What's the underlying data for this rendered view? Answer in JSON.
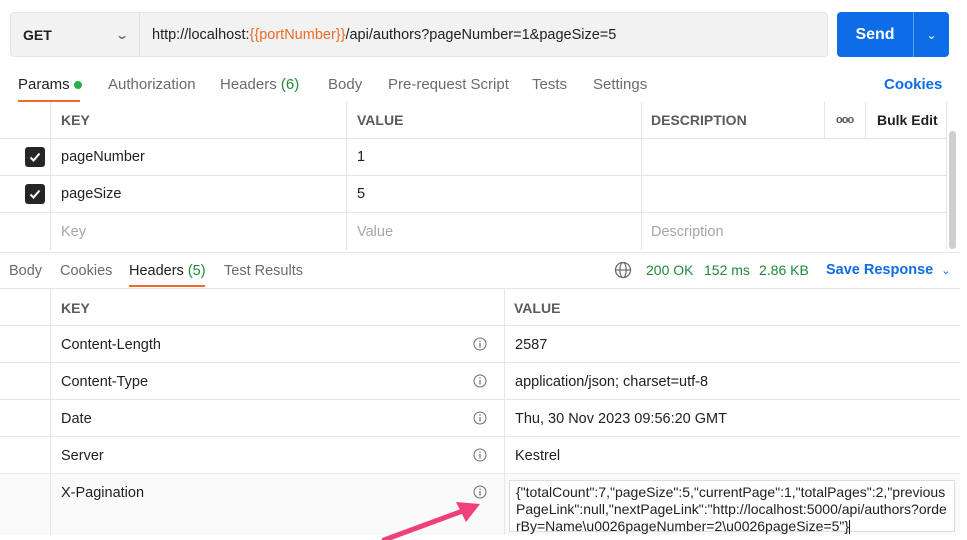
{
  "request": {
    "method": "GET",
    "url_prefix": "http://localhost:",
    "url_variable": "{{portNumber}}",
    "url_suffix": "/api/authors?pageNumber=1&pageSize=5",
    "send_label": "Send"
  },
  "req_tabs": {
    "params": "Params",
    "authorization": "Authorization",
    "headers": "Headers",
    "headers_count": "(6)",
    "body": "Body",
    "prerequest": "Pre-request Script",
    "tests": "Tests",
    "settings": "Settings",
    "cookies": "Cookies"
  },
  "params_table": {
    "col_key": "KEY",
    "col_value": "VALUE",
    "col_description": "DESCRIPTION",
    "more_label": "ooo",
    "bulk_edit": "Bulk Edit",
    "rows": [
      {
        "key": "pageNumber",
        "value": "1",
        "checked": true
      },
      {
        "key": "pageSize",
        "value": "5",
        "checked": true
      }
    ],
    "placeholder_key": "Key",
    "placeholder_value": "Value",
    "placeholder_description": "Description"
  },
  "res_tabs": {
    "body": "Body",
    "cookies": "Cookies",
    "headers": "Headers",
    "headers_count": "(5)",
    "test_results": "Test Results"
  },
  "status": {
    "code": "200 OK",
    "time": "152 ms",
    "size": "2.86 KB",
    "save_response": "Save Response"
  },
  "headers_table": {
    "col_key": "KEY",
    "col_value": "VALUE",
    "rows": [
      {
        "key": "Content-Length",
        "value": "2587"
      },
      {
        "key": "Content-Type",
        "value": "application/json; charset=utf-8"
      },
      {
        "key": "Date",
        "value": "Thu, 30 Nov 2023 09:56:20 GMT"
      },
      {
        "key": "Server",
        "value": "Kestrel"
      }
    ],
    "pagination_key": "X-Pagination",
    "pagination_value": "{\"totalCount\":7,\"pageSize\":5,\"currentPage\":1,\"totalPages\":2,\"previousPageLink\":null,\"nextPageLink\":\"http://localhost:5000/api/authors?orderBy=Name\\u0026pageNumber=2\\u0026pageSize=5\"}"
  },
  "colors": {
    "accent_blue": "#0d6de6",
    "tab_underline": "#ef6a2b",
    "status_green": "#1e8a3a",
    "annotation_arrow": "#f0407a"
  }
}
